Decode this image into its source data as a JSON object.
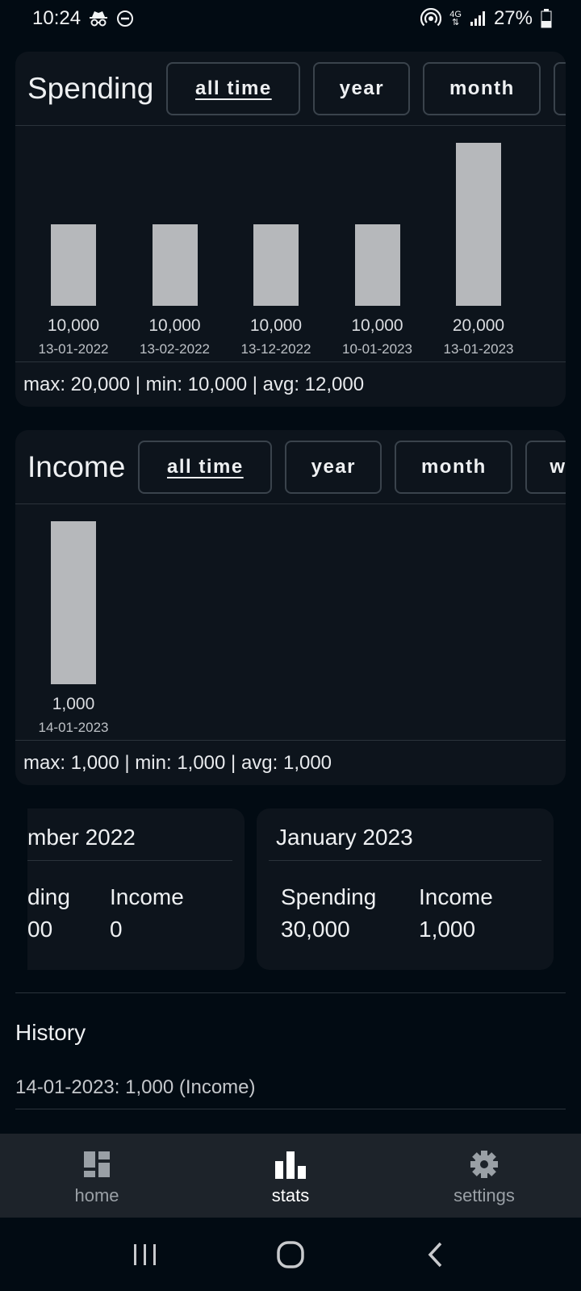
{
  "status_bar": {
    "time": "10:24",
    "battery": "27%"
  },
  "spending": {
    "title": "Spending",
    "periods": [
      "all time",
      "year",
      "month",
      ""
    ],
    "summary": "max: 20,000 | min: 10,000 | avg: 12,000"
  },
  "income": {
    "title": "Income",
    "periods": [
      "all time",
      "year",
      "month",
      "w"
    ],
    "summary": "max: 1,000 | min: 1,000 | avg: 1,000"
  },
  "chart_data": [
    {
      "type": "bar",
      "categories": [
        "13-01-2022",
        "13-02-2022",
        "13-12-2022",
        "10-01-2023",
        "13-01-2023"
      ],
      "values": [
        10000,
        10000,
        10000,
        10000,
        20000
      ],
      "value_labels": [
        "10,000",
        "10,000",
        "10,000",
        "10,000",
        "20,000"
      ],
      "title": "",
      "xlabel": "",
      "ylabel": "",
      "ylim": [
        0,
        20000
      ],
      "grid": false,
      "bar_color": "#b6b8bb"
    },
    {
      "type": "bar",
      "categories": [
        "14-01-2023"
      ],
      "values": [
        1000
      ],
      "value_labels": [
        "1,000"
      ],
      "title": "",
      "xlabel": "",
      "ylabel": "",
      "ylim": [
        0,
        1000
      ],
      "grid": false,
      "bar_color": "#b6b8bb"
    }
  ],
  "months": [
    {
      "title": "mber 2022",
      "spending_label": "ding",
      "spending_value": "00",
      "income_label": "Income",
      "income_value": "0"
    },
    {
      "title": "January 2023",
      "spending_label": "Spending",
      "spending_value": "30,000",
      "income_label": "Income",
      "income_value": "1,000"
    }
  ],
  "history": {
    "title": "History",
    "entries": [
      "14-01-2023: 1,000 (Income)"
    ]
  },
  "bottom_nav": [
    {
      "label": "home",
      "icon": "dashboard-icon"
    },
    {
      "label": "stats",
      "icon": "bar-chart-icon"
    },
    {
      "label": "settings",
      "icon": "gear-icon"
    }
  ],
  "colors": {
    "background": "#020b13",
    "card": "#0d141c",
    "bar": "#b6b8bb",
    "nav_background": "#1d232a"
  }
}
